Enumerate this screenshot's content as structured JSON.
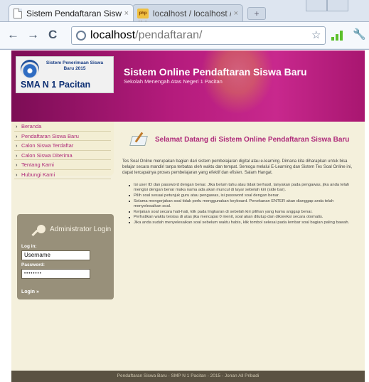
{
  "browser": {
    "tabs": [
      {
        "title": "Sistem Pendaftaran Siswa...",
        "close": "×",
        "icon": "page-icon"
      },
      {
        "title": "localhost / localhost / pe...",
        "close": "×",
        "icon": "pma-icon",
        "icon_text": "php MyA"
      }
    ],
    "new_tab": "+",
    "url_host": "localhost",
    "url_path": "/pendaftaran/",
    "star_icon": "☆",
    "wrench_icon": "🔧",
    "back_icon": "←",
    "forward_icon": "→",
    "reload_icon": "C"
  },
  "site": {
    "logo_sub": "Sistem Penerimaan Siswa Baru 2015",
    "logo_main": "SMA N 1 Pacitan",
    "title": "Sistem Online Pendaftaran Siswa Baru",
    "tagline": "Sekolah Menengah Atas Negeri 1 Pacitan"
  },
  "nav": [
    {
      "label": "Beranda"
    },
    {
      "label": "Pendaftaran Siswa Baru"
    },
    {
      "label": "Calon Siswa Terdaftar"
    },
    {
      "label": "Calon Siswa Diterima"
    },
    {
      "label": "Tentang Kami"
    },
    {
      "label": "Hubungi Kami"
    }
  ],
  "admin": {
    "title": "Administrator Login",
    "login_label": "Log in:",
    "username_value": "Username",
    "password_label": "Password:",
    "password_value": "••••••••",
    "login_link": "Login »"
  },
  "content": {
    "welcome_title": "Selamat Datang di Sistem Online Pendaftaran Siswa Baru",
    "intro": "Tes Soal Online merupakan bagian dari sistem pembelajaran digital atau e-learning. Dimana kita diharapkan untuk bisa belajar secara mandiri tanpa terbatas oleh waktu dan tempat. Semoga melalui E-Learning dan Sistem Tes Soal Online ini, dapat tercapainya proses pembelajaran yang efektif dan efisien. Salam Hangat.",
    "rules": [
      "Isi user ID dan password dengan benar. Jika belum tahu atau tidak berhasil, tanyakan pada pengawas, jika anda telah mengisi dengan benar maka nama ada akan muncul di layar sebelah kiri (side bar).",
      "Pilih soal sesuai petunjuk guru atau pengawas, isi password soal dengan benar.",
      "Selama mengerjakan soal tidak perlu menggunakan keyboard. Penekanan ENTER akan dianggap anda telah menyelesaikan soal.",
      "Kerjakan soal secara hati-hati, klik pada lingkaran di sebelah kiri pilihan yang kamu anggap benar.",
      "Perhatikan waktu tersisa di atas jika mencapai 0 menit, soal akan ditutup dan dikoreksi secara otomatis.",
      "Jika anda sudah menyelesaikan soal sebelum waktu habis, klik tombol selesai pada lembar soal bagian paling bawah."
    ]
  },
  "footer": {
    "text": "Pendaftaran Siswa Baru - SMP N 1 Pacitan - 2015 - Jonan All Pribadi"
  },
  "colors": {
    "header_magenta": "#b41b7c",
    "accent_text": "#ae2a7a",
    "sidebar_bg": "#f3eed4",
    "admin_bg": "#98907a",
    "footer_bg": "#5a5242"
  }
}
